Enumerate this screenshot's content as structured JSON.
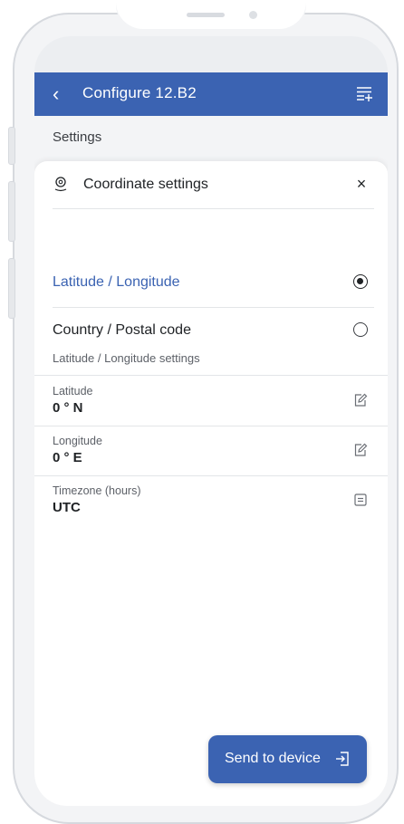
{
  "header": {
    "back_label": "‹",
    "title": "Configure 12.B2"
  },
  "settings": {
    "label": "Settings"
  },
  "panel": {
    "title": "Coordinate settings",
    "close_label": "×",
    "options": [
      {
        "label": "Latitude / Longitude",
        "selected": true
      },
      {
        "label": "Country / Postal code",
        "selected": false
      }
    ],
    "section_label": "Latitude / Longitude settings",
    "fields": [
      {
        "label": "Latitude",
        "value": "0 ° N",
        "icon": "edit-icon"
      },
      {
        "label": "Longitude",
        "value": "0 ° E",
        "icon": "edit-icon"
      },
      {
        "label": "Timezone (hours)",
        "value": "UTC",
        "icon": "list-icon"
      }
    ]
  },
  "footer": {
    "send_label": "Send to device",
    "send_icon": "enter-icon"
  },
  "colors": {
    "accent": "#3b63b2",
    "text": "#1f2225",
    "muted": "#5d6168"
  }
}
